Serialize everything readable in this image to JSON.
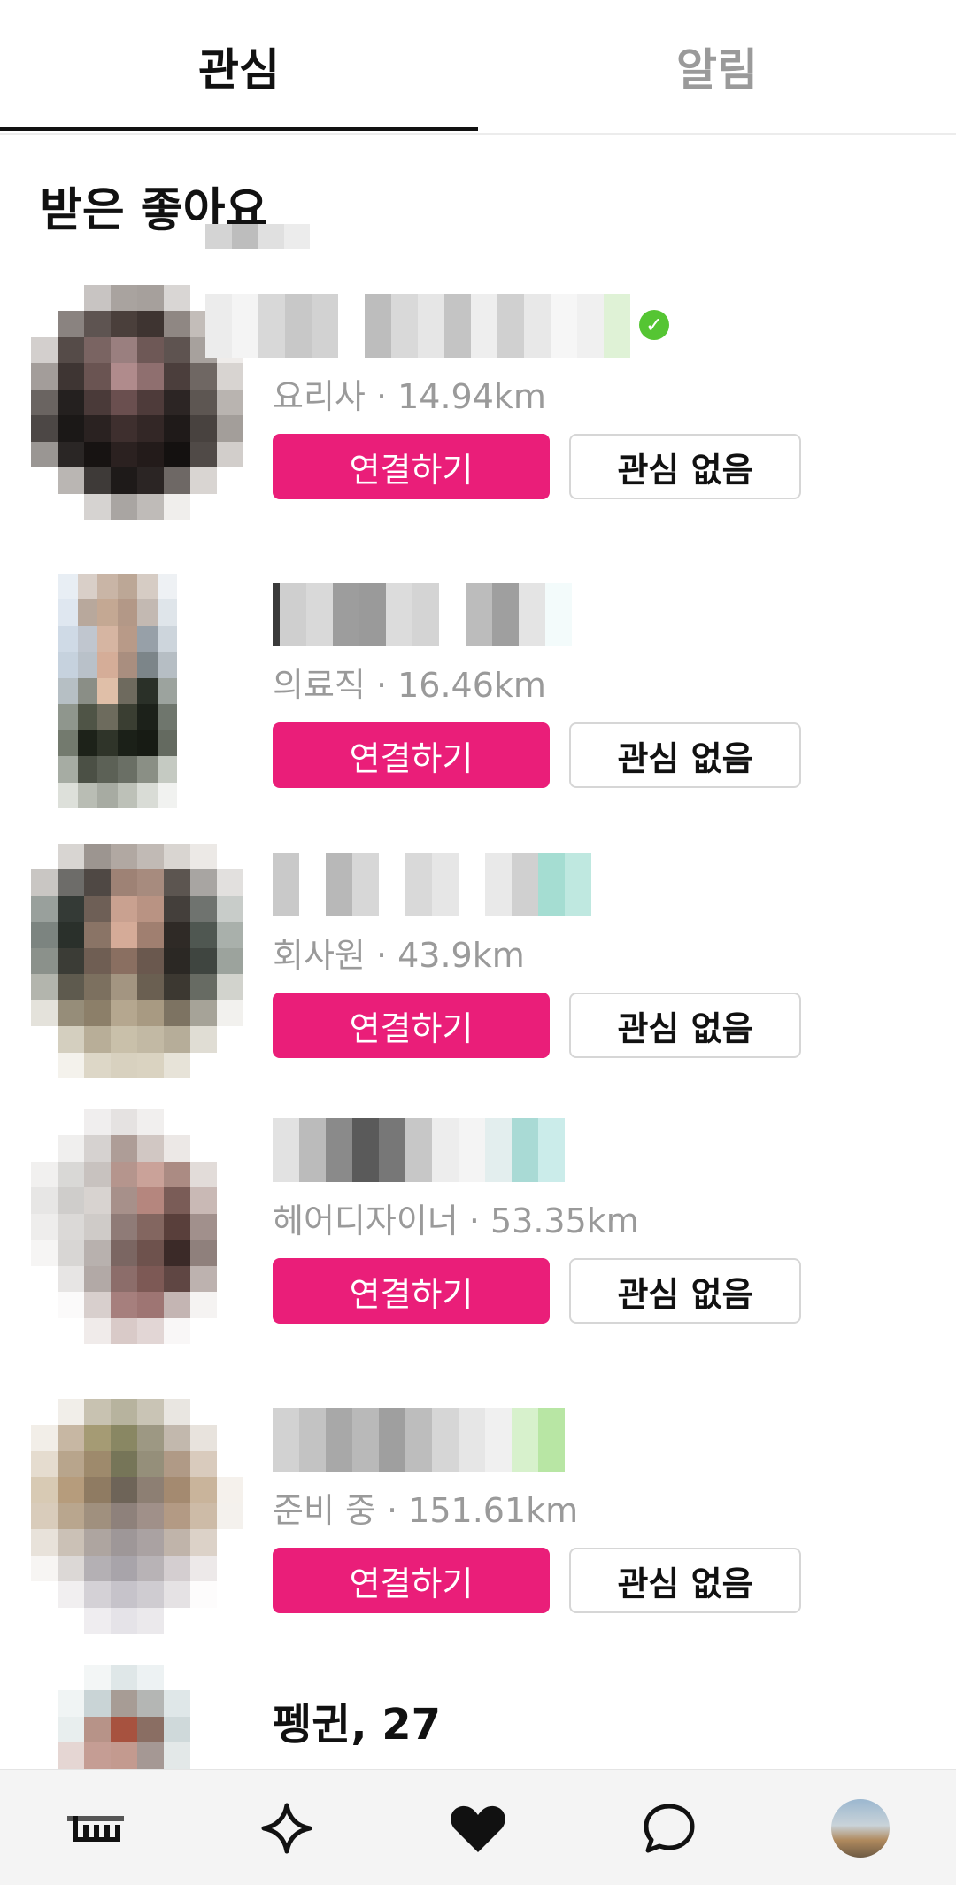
{
  "tabs": [
    {
      "label": "관심",
      "active": true
    },
    {
      "label": "알림",
      "active": false
    }
  ],
  "section": {
    "title": "받은 좋아요"
  },
  "cards": [
    {
      "subtitle": "요리사 · 14.94km",
      "verified": true,
      "connect_label": "연결하기",
      "pass_label": "관심 없음"
    },
    {
      "subtitle": "의료직 · 16.46km",
      "verified": false,
      "connect_label": "연결하기",
      "pass_label": "관심 없음"
    },
    {
      "subtitle": "회사원 · 43.9km",
      "verified": false,
      "connect_label": "연결하기",
      "pass_label": "관심 없음"
    },
    {
      "subtitle": "헤어디자이너 · 53.35km",
      "verified": false,
      "connect_label": "연결하기",
      "pass_label": "관심 없음"
    },
    {
      "subtitle": "준비 중 · 151.61km",
      "verified": false,
      "connect_label": "연결하기",
      "pass_label": "관심 없음"
    }
  ],
  "partial_card": {
    "name": "펭귄, 27"
  },
  "bottom_nav": [
    {
      "icon": "home-icon"
    },
    {
      "icon": "sparkle-icon"
    },
    {
      "icon": "heart-icon"
    },
    {
      "icon": "chat-bubble-icon"
    },
    {
      "icon": "profile-avatar"
    }
  ],
  "colors": {
    "accent": "#ea1e79",
    "verified": "#55c533"
  }
}
